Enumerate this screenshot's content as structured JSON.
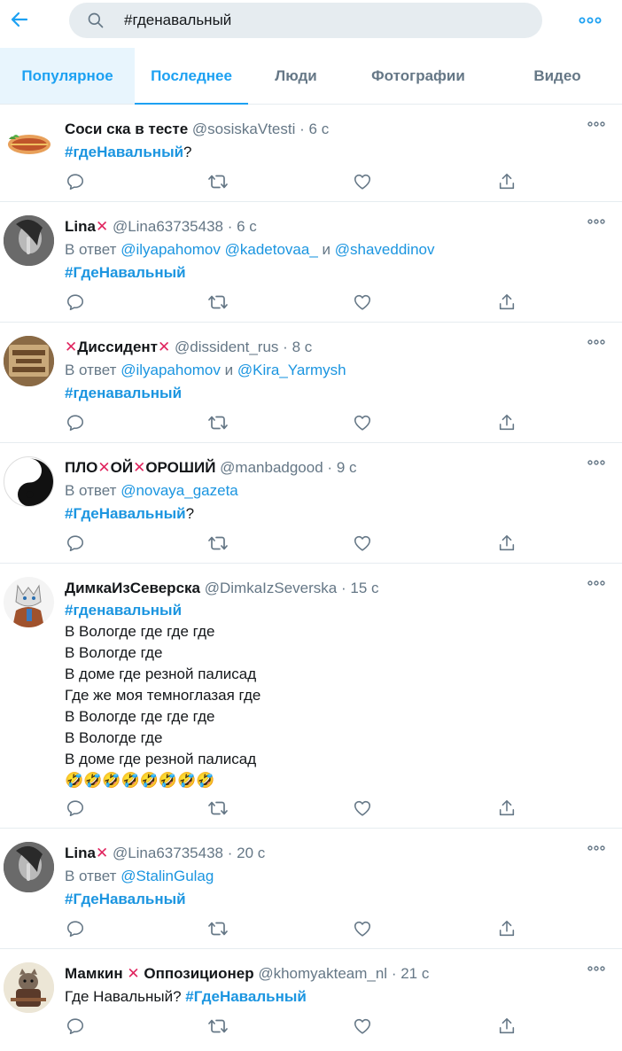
{
  "header": {
    "back_icon": "arrow-left-icon",
    "search_icon": "search-icon",
    "search_value": "#гденавальный",
    "more_icon": "more-dots-icon"
  },
  "tabs": [
    {
      "label": "Популярное"
    },
    {
      "label": "Последнее"
    },
    {
      "label": "Люди"
    },
    {
      "label": "Фотографии"
    },
    {
      "label": "Видео"
    }
  ],
  "colors": {
    "accent": "#1da1f2",
    "link": "#1b95e0",
    "muted": "#657786",
    "red_x": "#e0245e",
    "divider": "#e6ecf0"
  },
  "tweets": [
    {
      "name": "Соси ска в тесте",
      "handle": "@sosiskaVtesti",
      "time": "6 с",
      "hashtag": "#гдеНавальный",
      "suffix": "?"
    },
    {
      "name": "Lina",
      "handle": "@Lina63735438",
      "time": "6 с",
      "reply_prefix": "В ответ",
      "mention1": "@ilyapahomov",
      "mention2": "@kadetovaa_",
      "and": "и",
      "mention3": "@shaveddinov",
      "hashtag": "#ГдеНавальный"
    },
    {
      "name": "Диссидент",
      "handle": "@dissident_rus",
      "time": "8 с",
      "reply_prefix": "В ответ",
      "mention1": "@ilyapahomov",
      "and": "и",
      "mention2": "@Kira_Yarmysh",
      "hashtag": "#гденавальный"
    },
    {
      "name_part1": "ПЛО",
      "name_part2": "ОЙ",
      "name_part3": "ОРОШИЙ",
      "handle": "@manbadgood",
      "time": "9 с",
      "reply_prefix": "В ответ",
      "mention1": "@novaya_gazeta",
      "hashtag": "#ГдеНавальный",
      "suffix": "?"
    },
    {
      "name": "ДимкаИзСеверска",
      "handle": "@DimkaIzSeverska",
      "time": "15 с",
      "hashtag": "#гденавальный",
      "lines": [
        "В Вологде где где где",
        "В Вологде где",
        "В доме где резной палисад",
        "Где же моя темноглазая где",
        "В Вологде где где где",
        "В Вологде где",
        "В доме где резной палисад"
      ],
      "emojis": "🤣🤣🤣🤣🤣🤣🤣🤣"
    },
    {
      "name": "Lina",
      "handle": "@Lina63735438",
      "time": "20 с",
      "reply_prefix": "В ответ",
      "mention1": "@StalinGulag",
      "hashtag": "#ГдеНавальный"
    },
    {
      "name_part1": "Мамкин",
      "name_part2": "Оппозиционер",
      "handle": "@khomyakteam_nl",
      "time": "21 с",
      "text": "Где Навальный?",
      "hashtag": "#ГдеНавальный"
    }
  ],
  "action_icons": [
    "reply-icon",
    "retweet-icon",
    "like-icon",
    "share-icon"
  ],
  "sep": "·",
  "xmark": "✕"
}
